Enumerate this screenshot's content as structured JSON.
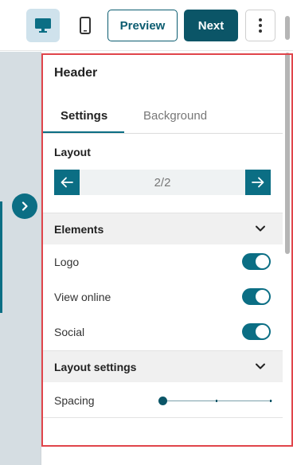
{
  "toolbar": {
    "preview_label": "Preview",
    "next_label": "Next",
    "active_device": "desktop"
  },
  "panel": {
    "title": "Header",
    "tabs": [
      {
        "label": "Settings",
        "active": true
      },
      {
        "label": "Background",
        "active": false
      }
    ],
    "layout": {
      "label": "Layout",
      "pager_text": "2/2"
    },
    "elements_section": {
      "label": "Elements",
      "items": [
        {
          "label": "Logo",
          "enabled": true
        },
        {
          "label": "View online",
          "enabled": true
        },
        {
          "label": "Social",
          "enabled": true
        }
      ]
    },
    "layout_settings_section": {
      "label": "Layout settings",
      "spacing": {
        "label": "Spacing",
        "value": 0
      }
    }
  },
  "colors": {
    "accent": "#0b6e84",
    "primary_button": "#0b5567",
    "highlight_border": "#e0454b"
  },
  "icons": {
    "desktop": "desktop-icon",
    "mobile": "mobile-icon",
    "more": "kebab-icon",
    "expand": "chevron-right-icon"
  }
}
